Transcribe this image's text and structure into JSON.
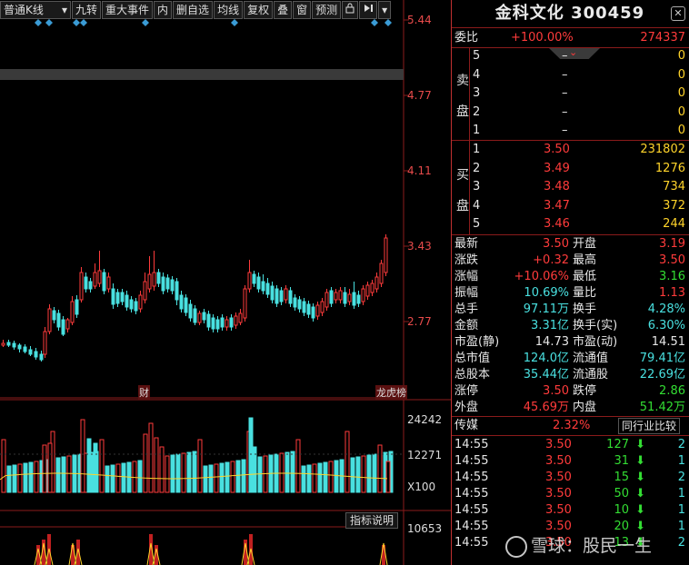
{
  "toolbar": {
    "period": "普通K线",
    "buttons": [
      "九转",
      "重大事件",
      "内",
      "删自选",
      "均线",
      "复权",
      "叠",
      "窗",
      "预测"
    ],
    "lock_icon": "lock-icon",
    "goto_icon": "skip-right-icon"
  },
  "price_axis": [
    "5.44",
    "4.77",
    "4.11",
    "3.43",
    "2.77"
  ],
  "volume_axis": [
    "24242",
    "12271",
    "X100"
  ],
  "indicator": {
    "label": "指标说明",
    "value": "10653"
  },
  "markers": {
    "cai": "财",
    "longhu": "龙虎榜"
  },
  "stock": {
    "name": "金科文化",
    "code": "300459"
  },
  "weibi": {
    "label": "委比",
    "ratio": "+100.00%",
    "diff": "274337"
  },
  "sell_label": [
    "卖",
    "盘"
  ],
  "buy_label": [
    "买",
    "盘"
  ],
  "sell_orders": [
    {
      "level": "5",
      "price": "–",
      "vol": "0"
    },
    {
      "level": "4",
      "price": "–",
      "vol": "0"
    },
    {
      "level": "3",
      "price": "–",
      "vol": "0"
    },
    {
      "level": "2",
      "price": "–",
      "vol": "0"
    },
    {
      "level": "1",
      "price": "–",
      "vol": "0"
    }
  ],
  "buy_orders": [
    {
      "level": "1",
      "price": "3.50",
      "vol": "231802"
    },
    {
      "level": "2",
      "price": "3.49",
      "vol": "1276"
    },
    {
      "level": "3",
      "price": "3.48",
      "vol": "734"
    },
    {
      "level": "4",
      "price": "3.47",
      "vol": "372"
    },
    {
      "level": "5",
      "price": "3.46",
      "vol": "244"
    }
  ],
  "stats": [
    {
      "l1": "最新",
      "v1": "3.50",
      "c1": "red",
      "l2": "开盘",
      "v2": "3.19",
      "c2": "red"
    },
    {
      "l1": "涨跌",
      "v1": "+0.32",
      "c1": "red",
      "l2": "最高",
      "v2": "3.50",
      "c2": "red"
    },
    {
      "l1": "涨幅",
      "v1": "+10.06%",
      "c1": "red",
      "l2": "最低",
      "v2": "3.16",
      "c2": "green"
    },
    {
      "l1": "振幅",
      "v1": "10.69%",
      "c1": "cyan",
      "l2": "量比",
      "v2": "1.13",
      "c2": "red"
    },
    {
      "l1": "总手",
      "v1": "97.11万",
      "c1": "cyan",
      "l2": "换手",
      "v2": "4.28%",
      "c2": "cyan"
    },
    {
      "l1": "金额",
      "v1": "3.31亿",
      "c1": "cyan",
      "l2": "换手(实)",
      "v2": "6.30%",
      "c2": "cyan"
    },
    {
      "l1": "市盈(静)",
      "v1": "14.73",
      "c1": "white",
      "l2": "市盈(动)",
      "v2": "14.51",
      "c2": "white"
    },
    {
      "l1": "总市值",
      "v1": "124.0亿",
      "c1": "cyan",
      "l2": "流通值",
      "v2": "79.41亿",
      "c2": "cyan"
    },
    {
      "l1": "总股本",
      "v1": "35.44亿",
      "c1": "cyan",
      "l2": "流通股",
      "v2": "22.69亿",
      "c2": "cyan"
    },
    {
      "l1": "涨停",
      "v1": "3.50",
      "c1": "red",
      "l2": "跌停",
      "v2": "2.86",
      "c2": "green"
    },
    {
      "l1": "外盘",
      "v1": "45.69万",
      "c1": "red",
      "l2": "内盘",
      "v2": "51.42万",
      "c2": "green"
    }
  ],
  "sector": {
    "name": "传媒",
    "pct": "2.32%",
    "compare": "同行业比较"
  },
  "ticks": [
    {
      "time": "14:55",
      "price": "3.50",
      "vol": "127",
      "n": "2"
    },
    {
      "time": "14:55",
      "price": "3.50",
      "vol": "31",
      "n": "1"
    },
    {
      "time": "14:55",
      "price": "3.50",
      "vol": "15",
      "n": "2"
    },
    {
      "time": "14:55",
      "price": "3.50",
      "vol": "50",
      "n": "1"
    },
    {
      "time": "14:55",
      "price": "3.50",
      "vol": "10",
      "n": "1"
    },
    {
      "time": "14:55",
      "price": "3.50",
      "vol": "20",
      "n": "1"
    },
    {
      "time": "14:55",
      "price": "3.50",
      "vol": "13",
      "n": "2"
    }
  ],
  "watermark": "雪球：股民一生",
  "colors": {
    "up": "#ff3b3b",
    "down": "#49e0e0",
    "ma": "#ffd42a",
    "grid": "#8b1b1b"
  }
}
